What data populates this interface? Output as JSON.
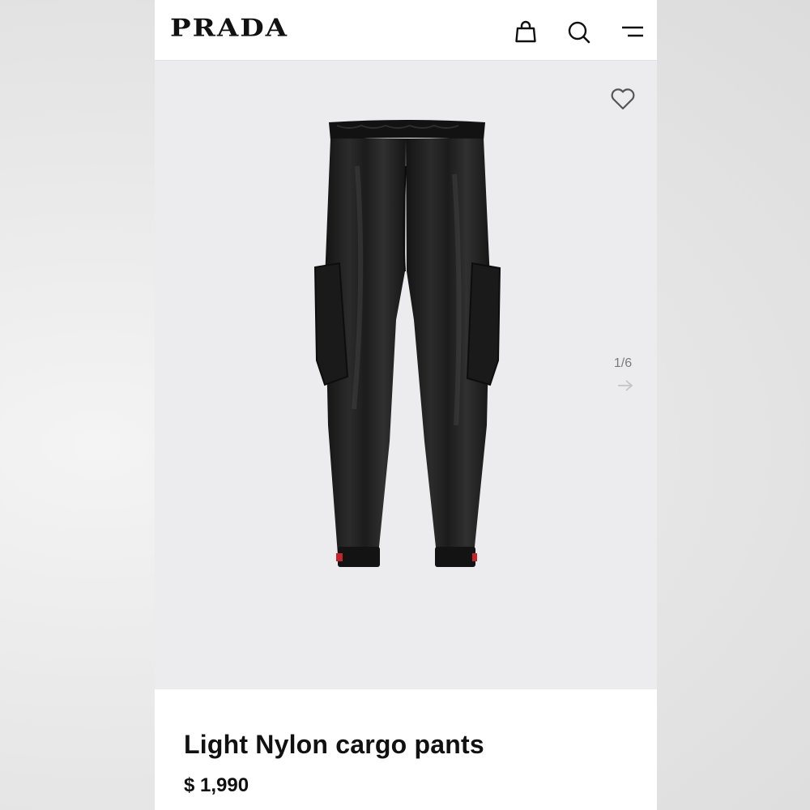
{
  "brand": {
    "logo_text": "PRADA"
  },
  "header": {
    "icons": [
      "shopping-bag-icon",
      "search-icon",
      "menu-icon"
    ]
  },
  "gallery": {
    "counter": "1/6",
    "wishlist_icon": "heart-icon",
    "next_icon": "arrow-right-icon",
    "background_color": "#ececee"
  },
  "product": {
    "name": "Light Nylon cargo pants",
    "price": "$ 1,990"
  },
  "colors": {
    "text": "#111111",
    "muted": "#7a7a7a",
    "accent_red": "#c2242c"
  }
}
